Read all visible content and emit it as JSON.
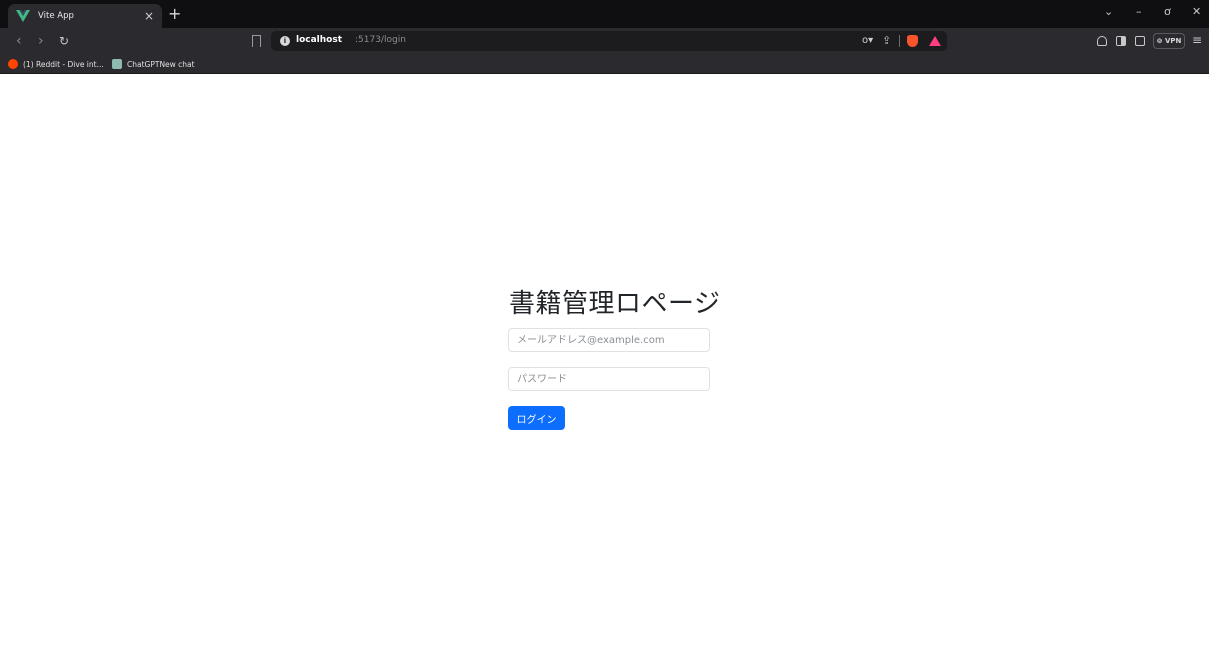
{
  "tab": {
    "title": "Vite App",
    "close": "×",
    "new_tab": "+"
  },
  "window_controls": {
    "minimize_chevron": "⌄",
    "minimize": "–",
    "restore": "ơ",
    "close": "✕"
  },
  "nav": {
    "back": "‹",
    "forward": "›",
    "reload": "↻"
  },
  "address": {
    "host": "localhost",
    "rest": ":5173/login",
    "info": "i",
    "key": "o▾",
    "share": "⇪"
  },
  "toolbar": {
    "vpn_label": "⊚ VPN",
    "menu": "≡"
  },
  "bookmarks": [
    {
      "label": "(1) Reddit - Dive int..."
    },
    {
      "label": "ChatGPTNew chat"
    }
  ],
  "login": {
    "title": "書籍管理ロページ",
    "email_placeholder": "メールアドレス@example.com",
    "password_placeholder": "パスワード",
    "submit_label": "ログイン"
  },
  "colors": {
    "primary": "#0d6efd",
    "tab_bg": "#0f0f11",
    "toolbar_bg": "#2b2b2f"
  },
  "icons": [
    "vue-logo-icon",
    "info-icon",
    "key-icon",
    "share-icon",
    "brave-shield-icon",
    "brave-rewards-icon",
    "extensions-icon",
    "sidebar-icon",
    "wallet-icon",
    "menu-icon"
  ]
}
